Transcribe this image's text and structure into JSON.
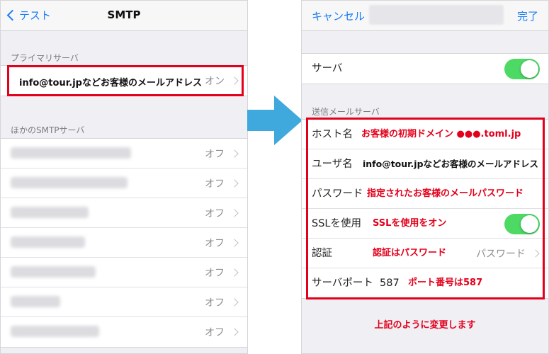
{
  "left": {
    "back_label": "テスト",
    "title": "SMTP",
    "primary_header": "プライマリサーバ",
    "primary_email": "info@tour.jpなどお客様のメールアドレス",
    "primary_status": "オン",
    "other_header": "ほかのSMTPサーバ",
    "other_servers": [
      {
        "status": "オフ"
      },
      {
        "status": "オフ"
      },
      {
        "status": "オフ"
      },
      {
        "status": "オフ"
      },
      {
        "status": "オフ"
      },
      {
        "status": "オフ"
      },
      {
        "status": "オフ"
      }
    ]
  },
  "right": {
    "cancel_label": "キャンセル",
    "done_label": "完了",
    "server_label": "サーバ",
    "server_on": true,
    "outgoing_header": "送信メールサーバ",
    "host_label": "ホスト名",
    "host_note": "お客様の初期ドメイン ●●●.toml.jp",
    "user_label": "ユーザ名",
    "user_value": "info@tour.jpなどお客様のメールアドレス",
    "password_label": "パスワード",
    "password_note": "指定されたお客様のメールパスワード",
    "ssl_label": "SSLを使用",
    "ssl_note": "SSLを使用をオン",
    "ssl_on": true,
    "auth_label": "認証",
    "auth_note": "認証はパスワード",
    "auth_value": "パスワード",
    "port_label": "サーバポート",
    "port_value": "587",
    "port_note": "ポート番号は587",
    "footer_note": "上記のように変更します"
  },
  "colors": {
    "accent": "#1a7cf5",
    "highlight": "#e3001b",
    "toggle_on": "#4cd964",
    "arrow": "#3fa9dd"
  }
}
